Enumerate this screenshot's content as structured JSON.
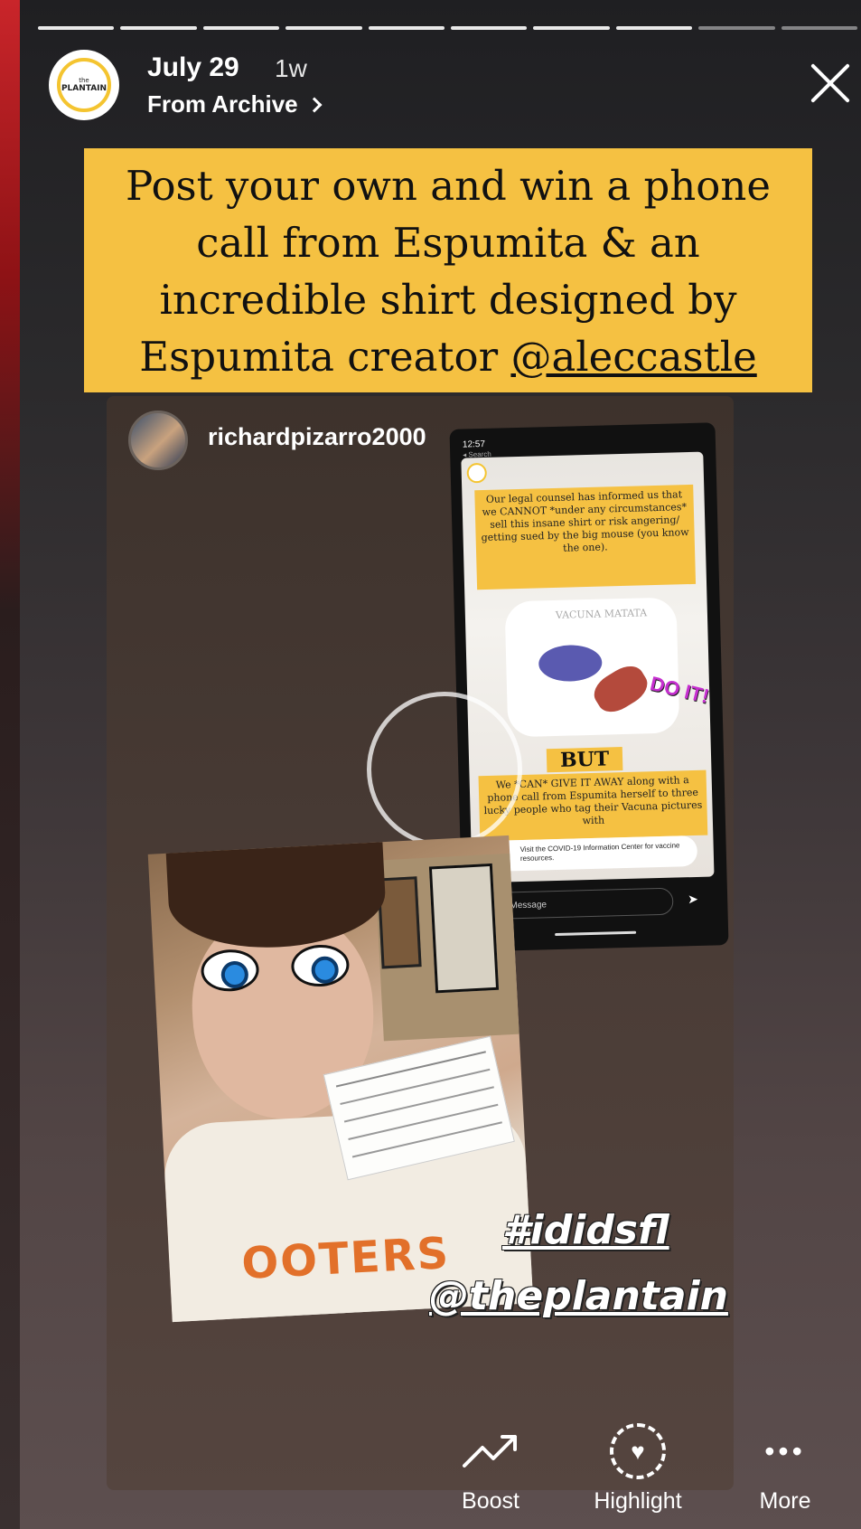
{
  "header": {
    "avatar_text_small": "the",
    "avatar_text": "PLANTAIN",
    "date": "July 29",
    "age": "1w",
    "subtitle": "From Archive"
  },
  "headline": {
    "text": "Post your own and win a phone call from Espumita & an incredible shirt designed by Espumita creator ",
    "mention": "@aleccastle"
  },
  "shared_post": {
    "username": "richardpizarro2000",
    "phone_time": "12:57",
    "phone_back": "◂ Search",
    "legal_text": "Our legal counsel has informed us that we CANNOT *under any circumstances* sell this insane shirt or risk angering/ getting sued by the big mouse (you know the one).",
    "shirt_text": "VACUNA MATATA",
    "doit": "DO IT!",
    "but": "BUT",
    "give_text": "We *CAN* GIVE IT AWAY along with a phone call from Espumita herself to three lucky people who tag their Vacuna pictures with",
    "covid_text": "Visit the COVID-19 Information Center for vaccine resources.",
    "send_placeholder": "Send Message",
    "shirt_print": "OOTERS"
  },
  "tags": [
    "#ididsfl",
    "@theplantain"
  ],
  "actions": [
    {
      "label": "Boost",
      "icon": "trend-icon"
    },
    {
      "label": "Highlight",
      "icon": "heart-circle-icon"
    },
    {
      "label": "More",
      "icon": "ellipsis-icon"
    }
  ],
  "colors": {
    "accent": "#f5c142",
    "text": "#ffffff"
  }
}
